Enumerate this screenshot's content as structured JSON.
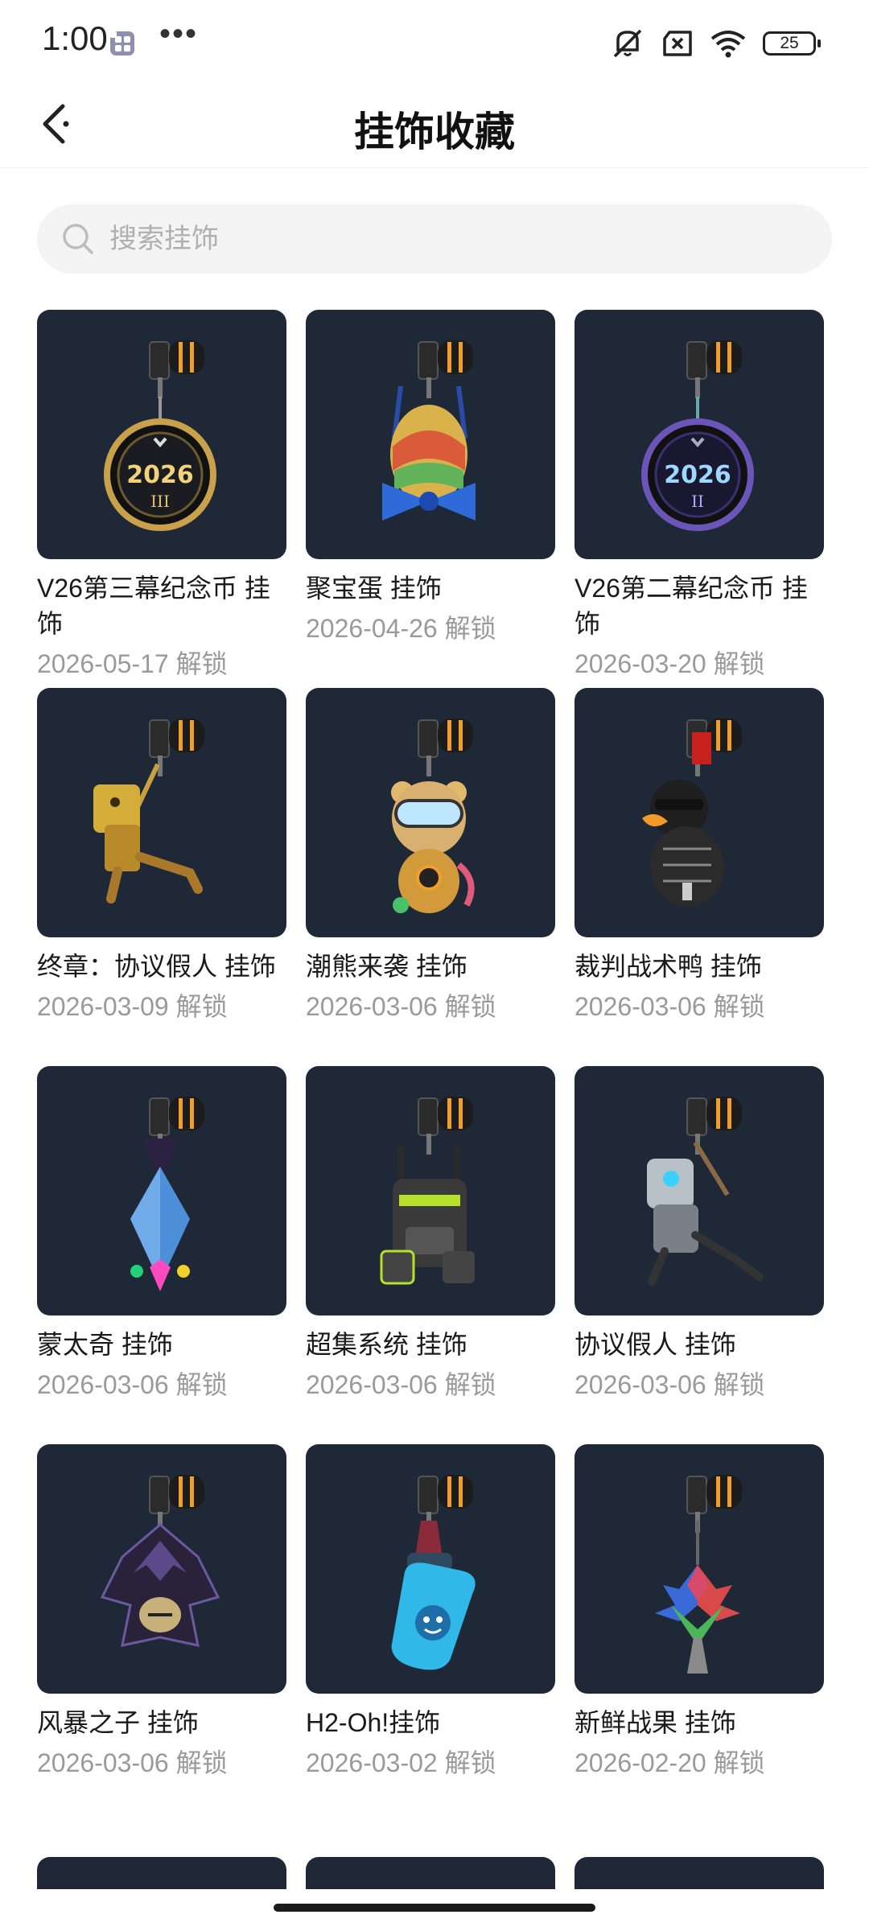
{
  "status_bar": {
    "time": "1:00",
    "dots": "•••",
    "battery": "25"
  },
  "header": {
    "title": "挂饰收藏"
  },
  "search": {
    "placeholder": "搜索挂饰"
  },
  "items": [
    {
      "name": "V26第三幕纪念币 挂饰",
      "date": "2026-05-17 解锁",
      "art": "coin-gold",
      "label": "2026",
      "sub": "III"
    },
    {
      "name": "聚宝蛋 挂饰",
      "date": "2026-04-26 解锁",
      "art": "egg"
    },
    {
      "name": "V26第二幕纪念币 挂饰",
      "date": "2026-03-20 解锁",
      "art": "coin-purple",
      "label": "2026",
      "sub": "II"
    },
    {
      "name": "终章：协议假人 挂饰",
      "date": "2026-03-09 解锁",
      "art": "gold-robot"
    },
    {
      "name": "潮熊来袭 挂饰",
      "date": "2026-03-06 解锁",
      "art": "bear"
    },
    {
      "name": "裁判战术鸭 挂饰",
      "date": "2026-03-06 解锁",
      "art": "duck"
    },
    {
      "name": "蒙太奇 挂饰",
      "date": "2026-03-06 解锁",
      "art": "crystal"
    },
    {
      "name": "超集系统 挂饰",
      "date": "2026-03-06 解锁",
      "art": "backpack"
    },
    {
      "name": "协议假人 挂饰",
      "date": "2026-03-06 解锁",
      "art": "robot"
    },
    {
      "name": "风暴之子 挂饰",
      "date": "2026-03-06 解锁",
      "art": "storm"
    },
    {
      "name": "H2-Oh!挂饰",
      "date": "2026-03-02 解锁",
      "art": "bottle"
    },
    {
      "name": "新鲜战果 挂饰",
      "date": "2026-02-20 解锁",
      "art": "tree"
    }
  ],
  "colors": {
    "thumb_bg": "#1e2836",
    "clip_orange": "#f0a02a",
    "date_gray": "#9a9a9a"
  }
}
